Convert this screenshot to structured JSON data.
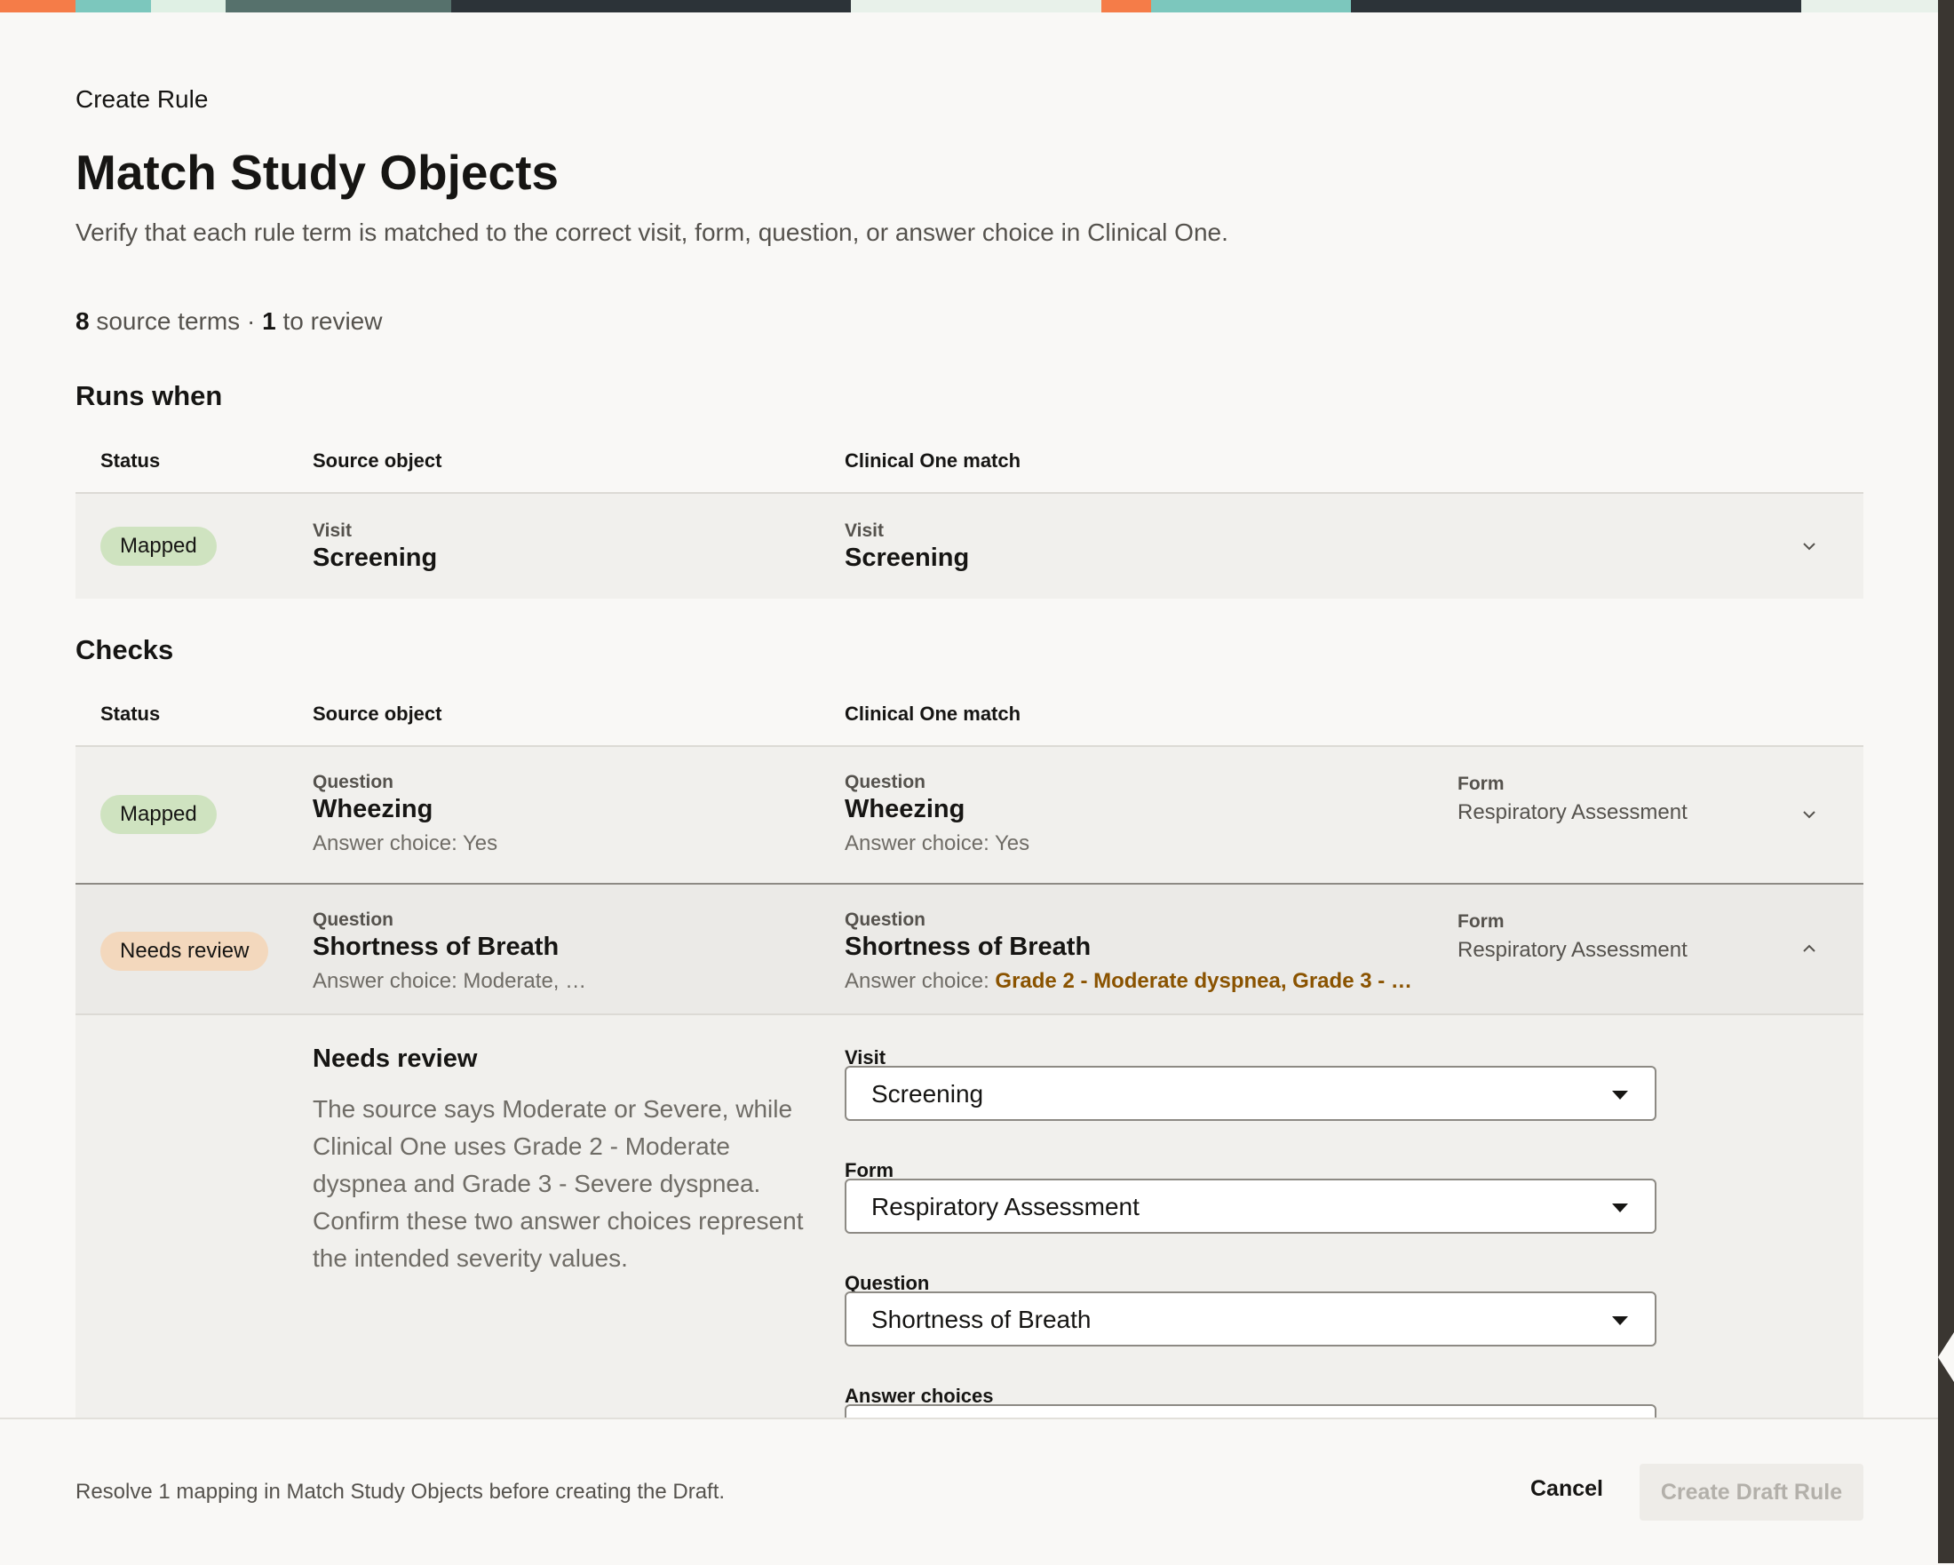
{
  "banner_colors": [
    "#f57c48",
    "#7cc7bd",
    "#dff0e4",
    "#4f6a67",
    "#2c3338",
    "#e8f1ea",
    "#f57c48",
    "#7cc7bd",
    "#2c3338",
    "#e8f1ea"
  ],
  "header": {
    "breadcrumb": "Create Rule",
    "title": "Match Study Objects",
    "subtitle": "Verify that each rule term is matched to the correct visit, form, question, or answer choice in Clinical One."
  },
  "summary": {
    "source_count": "8",
    "source_label": "source terms",
    "separator": "·",
    "review_count": "1",
    "review_label": "to review"
  },
  "runs_when": {
    "heading": "Runs when",
    "columns": {
      "status": "Status",
      "source": "Source object",
      "match": "Clinical One match"
    },
    "rows": [
      {
        "status": "Mapped",
        "source_type": "Visit",
        "source_name": "Screening",
        "match_type": "Visit",
        "match_name": "Screening"
      }
    ]
  },
  "checks": {
    "heading": "Checks",
    "columns": {
      "status": "Status",
      "source": "Source object",
      "match": "Clinical One match"
    },
    "rows": [
      {
        "status": "Mapped",
        "source_type": "Question",
        "source_name": "Wheezing",
        "source_answer": "Answer choice: Yes",
        "match_type": "Question",
        "match_name": "Wheezing",
        "match_answer": "Answer choice: Yes",
        "form_label": "Form",
        "form_value": "Respiratory Assessment"
      },
      {
        "status": "Needs review",
        "source_type": "Question",
        "source_name": "Shortness of Breath",
        "source_answer": "Answer choice: Moderate, …",
        "match_type": "Question",
        "match_name": "Shortness of Breath",
        "match_answer_prefix": "Answer choice: ",
        "match_answer_highlight": "Grade 2 - Moderate dyspnea, Grade 3 - …",
        "form_label": "Form",
        "form_value": "Respiratory Assessment"
      }
    ]
  },
  "detail": {
    "title": "Needs review",
    "text": "The source says Moderate or Severe, while Clinical One uses Grade 2 - Moderate dyspnea and Grade 3 - Severe dyspnea. Confirm these two answer choices represent the intended severity values.",
    "visit_label": "Visit",
    "visit_value": "Screening",
    "form_label": "Form",
    "form_value": "Respiratory Assessment",
    "question_label": "Question",
    "question_value": "Shortness of Breath",
    "answers_label": "Answer choices"
  },
  "footer": {
    "message": "Resolve 1 mapping in Match Study Objects before creating the Draft.",
    "cancel_label": "Cancel",
    "create_label": "Create Draft Rule"
  }
}
